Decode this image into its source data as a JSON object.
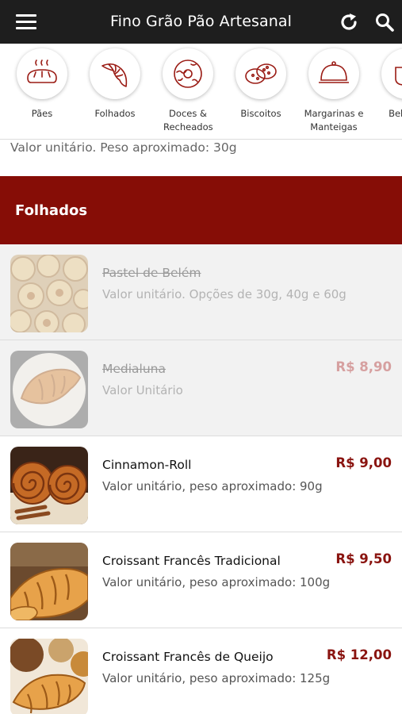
{
  "app": {
    "title": "Fino Grão Pão Artesanal"
  },
  "colors": {
    "topbar": "#1e1e1e",
    "section_header": "#860d06",
    "price": "#8a1410",
    "icon_stroke": "#9a1b14"
  },
  "categories": [
    {
      "label": "Pães",
      "icon": "bread-icon"
    },
    {
      "label": "Folhados",
      "icon": "croissant-icon"
    },
    {
      "label": "Doces & Recheados",
      "icon": "donut-icon"
    },
    {
      "label": "Biscoitos",
      "icon": "cookies-icon"
    },
    {
      "label": "Margarinas e Manteigas",
      "icon": "cloche-icon"
    },
    {
      "label": "Bebidas",
      "icon": "cup-icon"
    }
  ],
  "previous_item": {
    "description": "Valor unitário. Peso aproximado: 30g"
  },
  "section": {
    "title": "Folhados"
  },
  "items": [
    {
      "name": "Pastel de Belém",
      "description": "Valor unitário. Opções de 30g, 40g e 60g",
      "price": "",
      "available": false
    },
    {
      "name": "Medialuna",
      "description": "Valor Unitário",
      "price": "R$ 8,90",
      "available": false
    },
    {
      "name": "Cinnamon-Roll",
      "description": "Valor unitário, peso aproximado: 90g",
      "price": "R$ 9,00",
      "available": true
    },
    {
      "name": "Croissant Francês Tradicional",
      "description": "Valor unitário, peso aproximado: 100g",
      "price": "R$ 9,50",
      "available": true
    },
    {
      "name": "Croissant Francês de Queijo",
      "description": "Valor unitário, peso aproximado: 125g",
      "price": "R$ 12,00",
      "available": true
    }
  ]
}
